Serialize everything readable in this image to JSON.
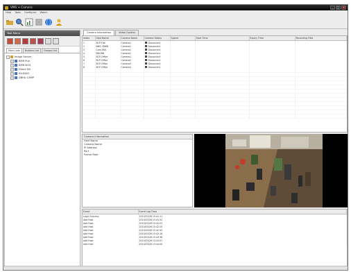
{
  "window": {
    "title": "VMS + Camera",
    "min": "_",
    "max": "□",
    "close": "×"
  },
  "menu": [
    "Help",
    "Tools",
    "Configure",
    "Watch"
  ],
  "toolbar": [
    "open-icon",
    "search-icon",
    "chart-icon",
    "list-icon",
    "globe-icon",
    "user-icon"
  ],
  "left_panel": {
    "header": "Tool Menu",
    "tabs": [
      "Main Lists",
      "Buttons List",
      "Groups List"
    ],
    "tree": [
      {
        "label": "Image Server",
        "level": 0
      },
      {
        "label": "BMR Pub",
        "level": 1
      },
      {
        "label": "BMR W.St",
        "level": 1
      },
      {
        "label": "Direct NS",
        "level": 1
      },
      {
        "label": "KH-B002",
        "level": 1
      },
      {
        "label": "DBHU CAMP",
        "level": 1
      }
    ]
  },
  "tabs": [
    "Camera Information",
    "Video Control"
  ],
  "device_table": {
    "columns": [
      "Index",
      "Host Name",
      "Camera Name",
      "Camera Status",
      "Speed",
      "Start Time",
      "Expiry Time",
      "Recording Files"
    ],
    "rows": [
      [
        "1",
        "BCP-Flat",
        "Camera1",
        "Disconnect"
      ],
      [
        "2",
        "BMS-7BWB",
        "Camera1",
        "Disconnect"
      ],
      [
        "3",
        "Cam.FAN",
        "Camera1",
        "Disconnect"
      ],
      [
        "4",
        "BDGBN",
        "Camera1",
        "Disconnect"
      ],
      [
        "5",
        "BCP-Office",
        "Camera1",
        "Disconnect"
      ],
      [
        "6",
        "BCP-Office",
        "Camera2",
        "Disconnect"
      ],
      [
        "7",
        "BCP-Office",
        "Camera3",
        "Disconnect"
      ],
      [
        "8",
        "BCP-Office",
        "Camera4",
        "Disconnect"
      ]
    ]
  },
  "info_panel": {
    "header": "Camera Information",
    "fields": [
      "Host Name",
      "Camera Name",
      "IP Address",
      "Port",
      "Frame Rate"
    ]
  },
  "log": {
    "columns": [
      "Event",
      "Event Log Time"
    ],
    "rows": [
      [
        "Login Success",
        "2010/03/26 15:41:11"
      ],
      [
        "Add Host",
        "2010/03/26 15:41:52"
      ],
      [
        "Add Host",
        "2010/03/26 15:42:03"
      ],
      [
        "Add Host",
        "2010/03/26 15:42:25"
      ],
      [
        "Add Host",
        "2010/03/26 15:42:45"
      ],
      [
        "Add Host",
        "2010/03/26 15:43:16"
      ],
      [
        "Add Host",
        "2010/03/26 15:43:38"
      ],
      [
        "Add Host",
        "2010/03/26 15:43:51"
      ],
      [
        "Add Host",
        "2010/03/26 15:44:00"
      ]
    ]
  },
  "colors": {
    "titlebar": "#111111",
    "panel_header": "#555555",
    "tree_icon": "#4a72c4"
  }
}
